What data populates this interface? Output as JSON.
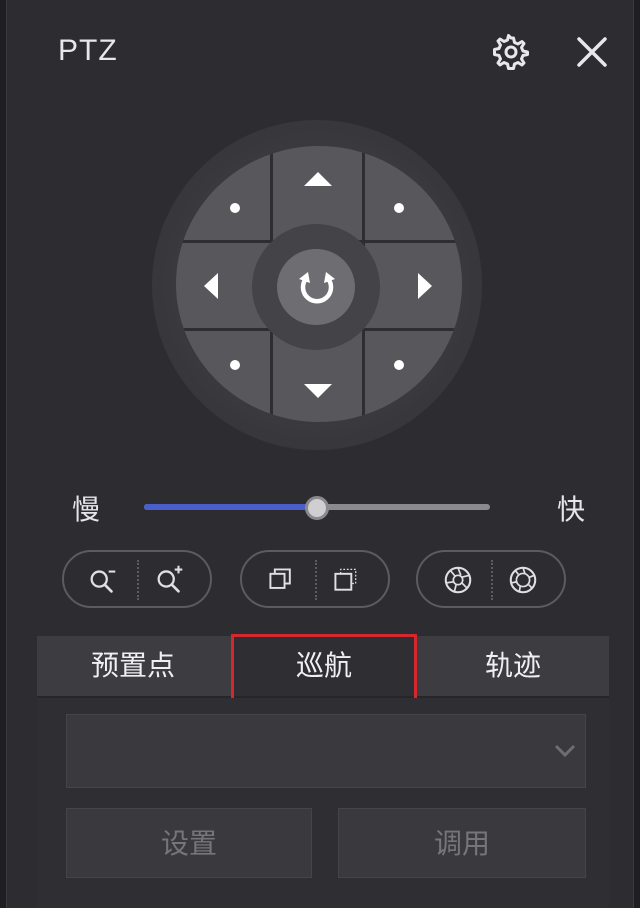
{
  "header": {
    "title": "PTZ",
    "settings_icon": "gear-icon",
    "close_icon": "close-icon"
  },
  "direction_pad": {
    "up_icon": "triangle-up-icon",
    "down_icon": "triangle-down-icon",
    "left_icon": "triangle-left-icon",
    "right_icon": "triangle-right-icon",
    "diagonal_icon": "dot-icon",
    "center_icon": "rotate-icon"
  },
  "speed": {
    "slow_label": "慢",
    "fast_label": "快",
    "level": 0.5,
    "accent": "#4a5fc9"
  },
  "lens_controls": [
    {
      "name": "zoom",
      "left_icon": "zoom-out-icon",
      "right_icon": "zoom-in-icon"
    },
    {
      "name": "focus",
      "left_icon": "focus-near-icon",
      "right_icon": "focus-far-icon"
    },
    {
      "name": "iris",
      "left_icon": "iris-close-icon",
      "right_icon": "iris-open-icon"
    }
  ],
  "tabs": [
    {
      "label": "预置点"
    },
    {
      "label": "巡航",
      "active": true
    },
    {
      "label": "轨迹"
    }
  ],
  "tab_content": {
    "dropdown_value": "",
    "dropdown_icon": "chevron-down-icon",
    "set_label": "设置",
    "call_label": "调用"
  },
  "highlight_color": "#d6262e"
}
